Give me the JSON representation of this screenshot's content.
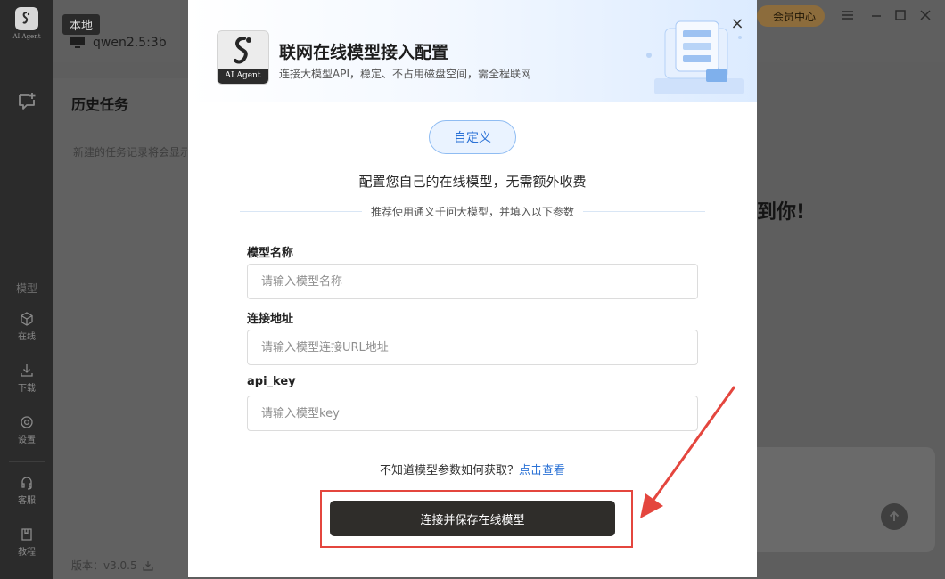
{
  "app": {
    "logo_text": "AI Agent",
    "local_badge": "本地",
    "model_name": "qwen2.5:3b",
    "history_title": "历史任务",
    "history_empty": "新建的任务记录将会显示在这里",
    "welcome_fragment": "到你!",
    "version": "版本：v3.0.5",
    "vip_label": "会员中心",
    "sidebar": {
      "section_label": "模型",
      "items": [
        {
          "label": "在线",
          "icon": "cube-icon"
        },
        {
          "label": "下载",
          "icon": "download-icon"
        },
        {
          "label": "设置",
          "icon": "settings-icon"
        },
        {
          "label": "客服",
          "icon": "headset-icon"
        },
        {
          "label": "教程",
          "icon": "book-icon"
        }
      ]
    }
  },
  "modal": {
    "title": "联网在线模型接入配置",
    "subtitle": "连接大模型API，稳定、不占用磁盘空间，需全程联网",
    "logo_text": "AI Agent",
    "close_symbol": "×",
    "custom_tab": "自定义",
    "headline": "配置您自己的在线模型，无需额外收费",
    "hint": "推荐使用通义千问大模型，并填入以下参数",
    "fields": [
      {
        "label": "模型名称",
        "placeholder": "请输入模型名称",
        "value": ""
      },
      {
        "label": "连接地址",
        "placeholder": "请输入模型连接URL地址",
        "value": ""
      },
      {
        "label": "api_key",
        "placeholder": "请输入模型key",
        "value": ""
      }
    ],
    "help_text": "不知道模型参数如何获取？",
    "help_link": "点击查看",
    "connect_button": "连接并保存在线模型"
  },
  "colors": {
    "accent_blue": "#2b72d6",
    "button_dark": "#2f2d2a",
    "annotation_red": "#e4463e",
    "overlay_gray": "#5e5e5e"
  }
}
